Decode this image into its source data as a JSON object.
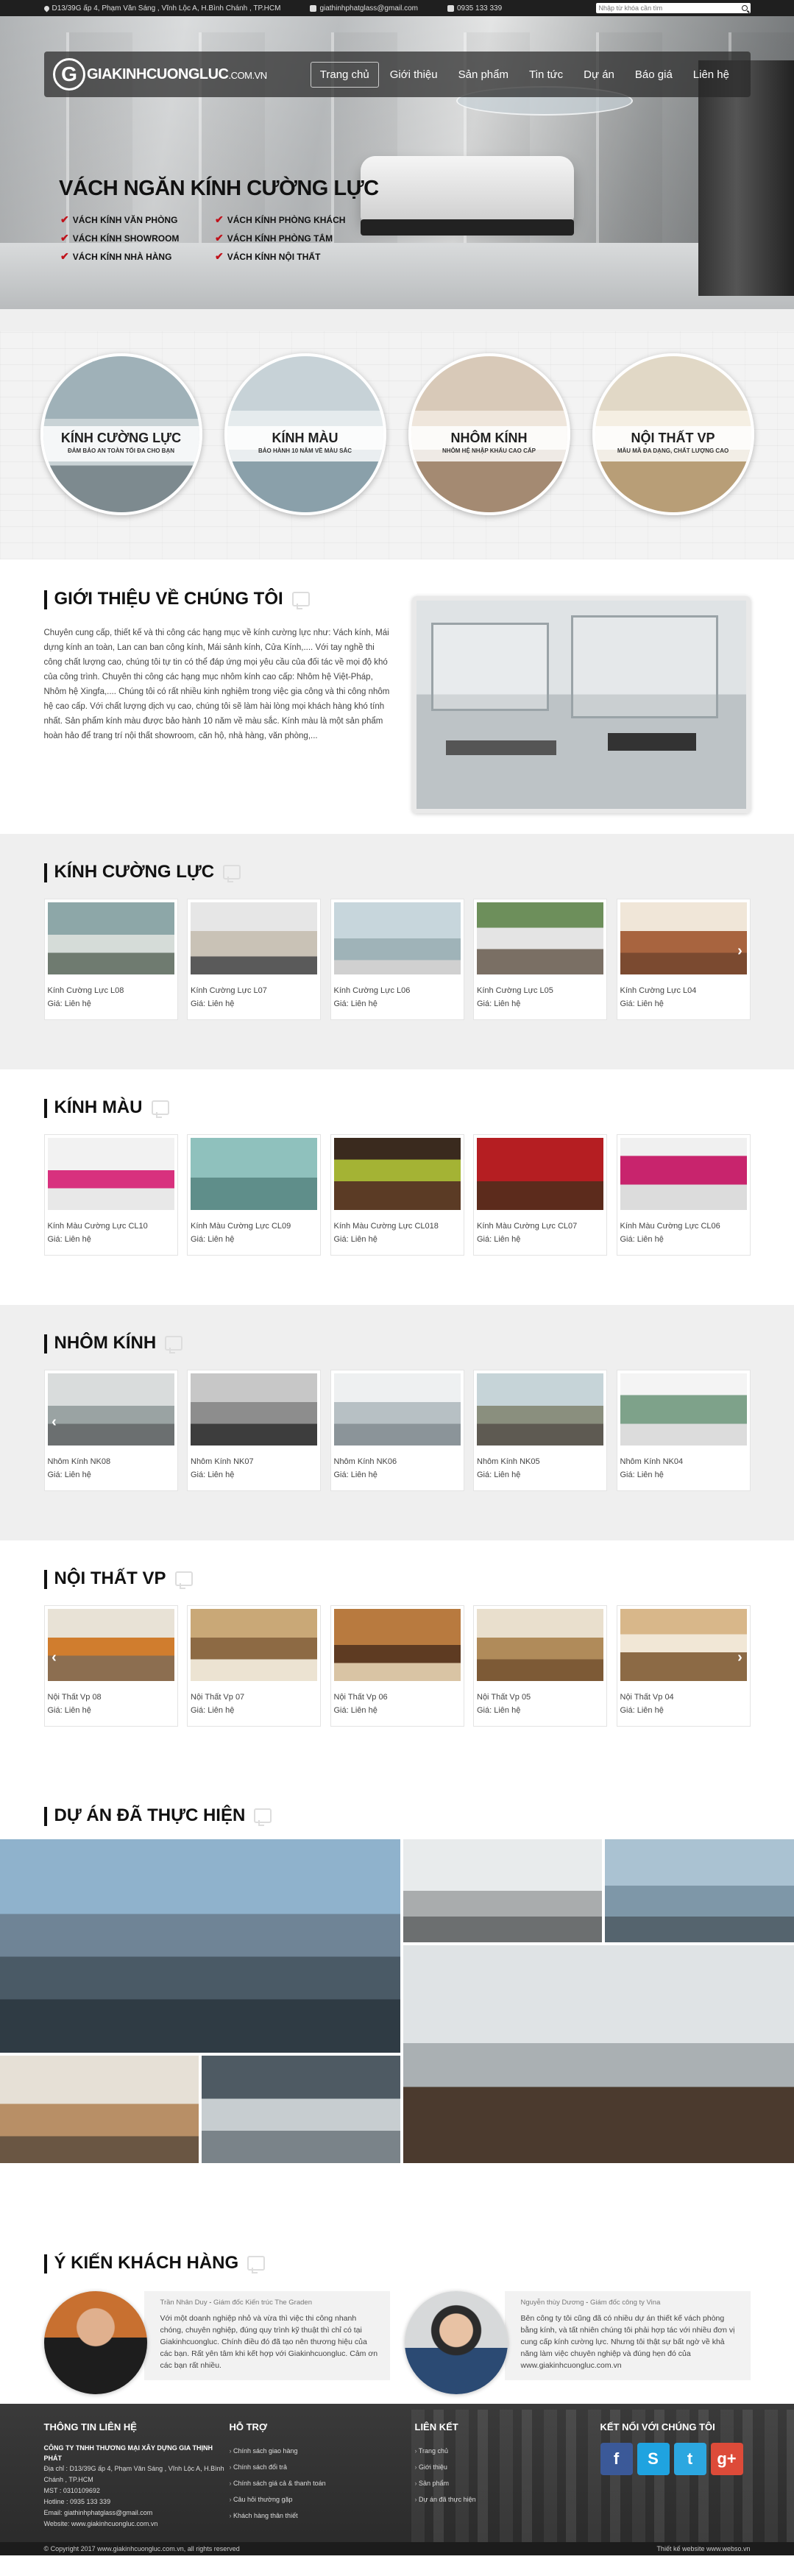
{
  "topbar": {
    "address": "D13/39G ấp 4, Phạm Văn Sáng , Vĩnh Lộc A, H.Bình Chánh , TP.HCM",
    "email": "giathinhphatglass@gmail.com",
    "phone": "0935 133 339",
    "search_placeholder": "Nhập từ khóa cần tìm"
  },
  "header": {
    "logo_main": "GIAKINHCUONGLUC",
    "logo_suffix": ".COM.VN",
    "nav": [
      "Trang chủ",
      "Giới thiệu",
      "Sản phẩm",
      "Tin tức",
      "Dự án",
      "Báo giá",
      "Liên hệ"
    ]
  },
  "hero": {
    "title": "VÁCH NGĂN KÍNH CƯỜNG LỰC",
    "items": [
      "VÁCH KÍNH VĂN PHÒNG",
      "VÁCH KÍNH PHÒNG KHÁCH",
      "VÁCH KÍNH SHOWROOM",
      "VÁCH KÍNH PHÒNG TẮM",
      "VÁCH KÍNH NHÀ HÀNG",
      "VÁCH KÍNH NỘI THẤT"
    ]
  },
  "categories": [
    {
      "title": "KÍNH CƯỜNG LỰC",
      "subtitle": "ĐẢM BẢO AN TOÀN TỐI ĐA CHO BẠN"
    },
    {
      "title": "KÍNH MÀU",
      "subtitle": "BẢO HÀNH 10 NĂM VỀ MÀU SẮC"
    },
    {
      "title": "NHÔM KÍNH",
      "subtitle": "NHÔM HỆ NHẬP KHẨU CAO CẤP"
    },
    {
      "title": "NỘI THẤT VP",
      "subtitle": "MẪU MÃ ĐA DẠNG, CHẤT LƯỢNG CAO"
    }
  ],
  "intro": {
    "title": "GIỚI THIỆU VỀ CHÚNG TÔI",
    "text": "Chuyên cung cấp, thiết kế và thi công các hạng mục về kính cường lực như: Vách kính, Mái dựng kính an toàn, Lan can ban công kính, Mái sảnh kính, Cửa Kính,.... Với tay nghề thi công chất lượng cao, chúng tôi tự tin có thể đáp ứng mọi yêu cầu của đối tác về mọi độ khó của công trình. Chuyên thi công các hạng mục nhôm kính cao cấp: Nhôm hệ Việt-Pháp, Nhôm hệ Xingfa,.... Chúng tôi có rất nhiều kinh nghiệm trong việc gia công và thi công nhôm hệ cao cấp. Với chất lượng dịch vụ cao, chúng tôi sẽ làm hài lòng mọi khách hàng khó tính nhất. Sản phẩm kính màu được bảo hành 10 năm về màu sắc. Kính màu là một sản phẩm hoàn hảo để trang trí nội thất showroom, căn hộ, nhà hàng, văn phòng,..."
  },
  "sections": [
    {
      "title": "KÍNH CƯỜNG LỰC",
      "price_label": "Giá: Liên hệ",
      "items": [
        "Kính Cường Lực L08",
        "Kính Cường Lực L07",
        "Kính Cường Lực L06",
        "Kính Cường Lực L05",
        "Kính Cường Lực L04"
      ]
    },
    {
      "title": "KÍNH MÀU",
      "price_label": "Giá: Liên hệ",
      "items": [
        "Kính Màu Cường Lực CL10",
        "Kính Màu Cường Lực CL09",
        "Kính Màu Cường Lực CL018",
        "Kính Màu Cường Lực CL07",
        "Kính Màu Cường Lực CL06"
      ]
    },
    {
      "title": "NHÔM KÍNH",
      "price_label": "Giá: Liên hệ",
      "items": [
        "Nhôm Kính NK08",
        "Nhôm Kính NK07",
        "Nhôm Kính NK06",
        "Nhôm Kính NK05",
        "Nhôm Kính NK04"
      ]
    },
    {
      "title": "NỘI THẤT VP",
      "price_label": "Giá: Liên hệ",
      "items": [
        "Nội Thất Vp 08",
        "Nội Thất Vp 07",
        "Nội Thất Vp 06",
        "Nội Thất Vp 05",
        "Nội Thất Vp 04"
      ]
    }
  ],
  "projects": {
    "title": "DỰ ÁN ĐÃ THỰC HIỆN"
  },
  "testimonials": {
    "title": "Ý KIẾN KHÁCH HÀNG",
    "items": [
      {
        "name": "Trần Nhân Duy",
        "role": "Giám đốc Kiến trúc The Graden",
        "text": "Với một doanh nghiệp nhỏ và vừa thì việc thi công nhanh chóng, chuyên nghiệp, đúng quy trình kỹ thuật thì chỉ có tại Giakinhcuongluc. Chính điều đó đã tạo nên thương hiệu của các bạn. Rất yên tâm khi kết hợp với Giakinhcuongluc. Cảm ơn các bạn rất nhiều."
      },
      {
        "name": "Nguyễn thùy Dương",
        "role": "Giám đốc công ty Vina",
        "text": "Bên công ty tôi cũng đã có nhiều dự án thiết kế vách phòng bằng kính, và tất nhiên chúng tôi phải hợp tác với nhiều đơn vị cung cấp kính cường lực. Nhưng tôi thật sự bất ngờ về khả năng làm việc chuyên nghiệp và đúng hẹn đó của www.giakinhcuongluc.com.vn"
      }
    ]
  },
  "footer": {
    "contact_title": "THÔNG TIN LIÊN HỆ",
    "company": "CÔNG TY TNHH THƯƠNG MẠI XÂY DỰNG GIA THỊNH PHÁT",
    "address": "Địa chỉ : D13/39G ấp 4, Phạm Văn Sáng , Vĩnh Lộc A, H.Bình Chánh , TP.HCM",
    "mst": "MST : 0310109692",
    "hotline": "Hotline : 0935 133 339",
    "email": "Email: giathinhphatglass@gmail.com",
    "website": "Website: www.giakinhcuongluc.com.vn",
    "support_title": "HỖ TRỢ",
    "support": [
      "Chính sách giao hàng",
      "Chính sách đổi trả",
      "Chính sách giá cả & thanh toán",
      "Câu hỏi thường gặp",
      "Khách hàng thân thiết"
    ],
    "links_title": "LIÊN KẾT",
    "links": [
      "Trang chủ",
      "Giới thiệu",
      "Sản phẩm",
      "Dự án đã thực hiện"
    ],
    "social_title": "KẾT NỐI VỚI CHÚNG TÔI",
    "social": [
      {
        "icon": "facebook-icon",
        "glyph": "f",
        "color": "#3b5998"
      },
      {
        "icon": "skype-icon",
        "glyph": "S",
        "color": "#1fa3e0"
      },
      {
        "icon": "twitter-icon",
        "glyph": "t",
        "color": "#2ca7e0"
      },
      {
        "icon": "google-plus-icon",
        "glyph": "g+",
        "color": "#dd4b39"
      }
    ],
    "copyright": "© Copyright 2017 www.giakinhcuongluc.com.vn, all rights reserved",
    "credit": "Thiết kế website www.webso.vn"
  }
}
